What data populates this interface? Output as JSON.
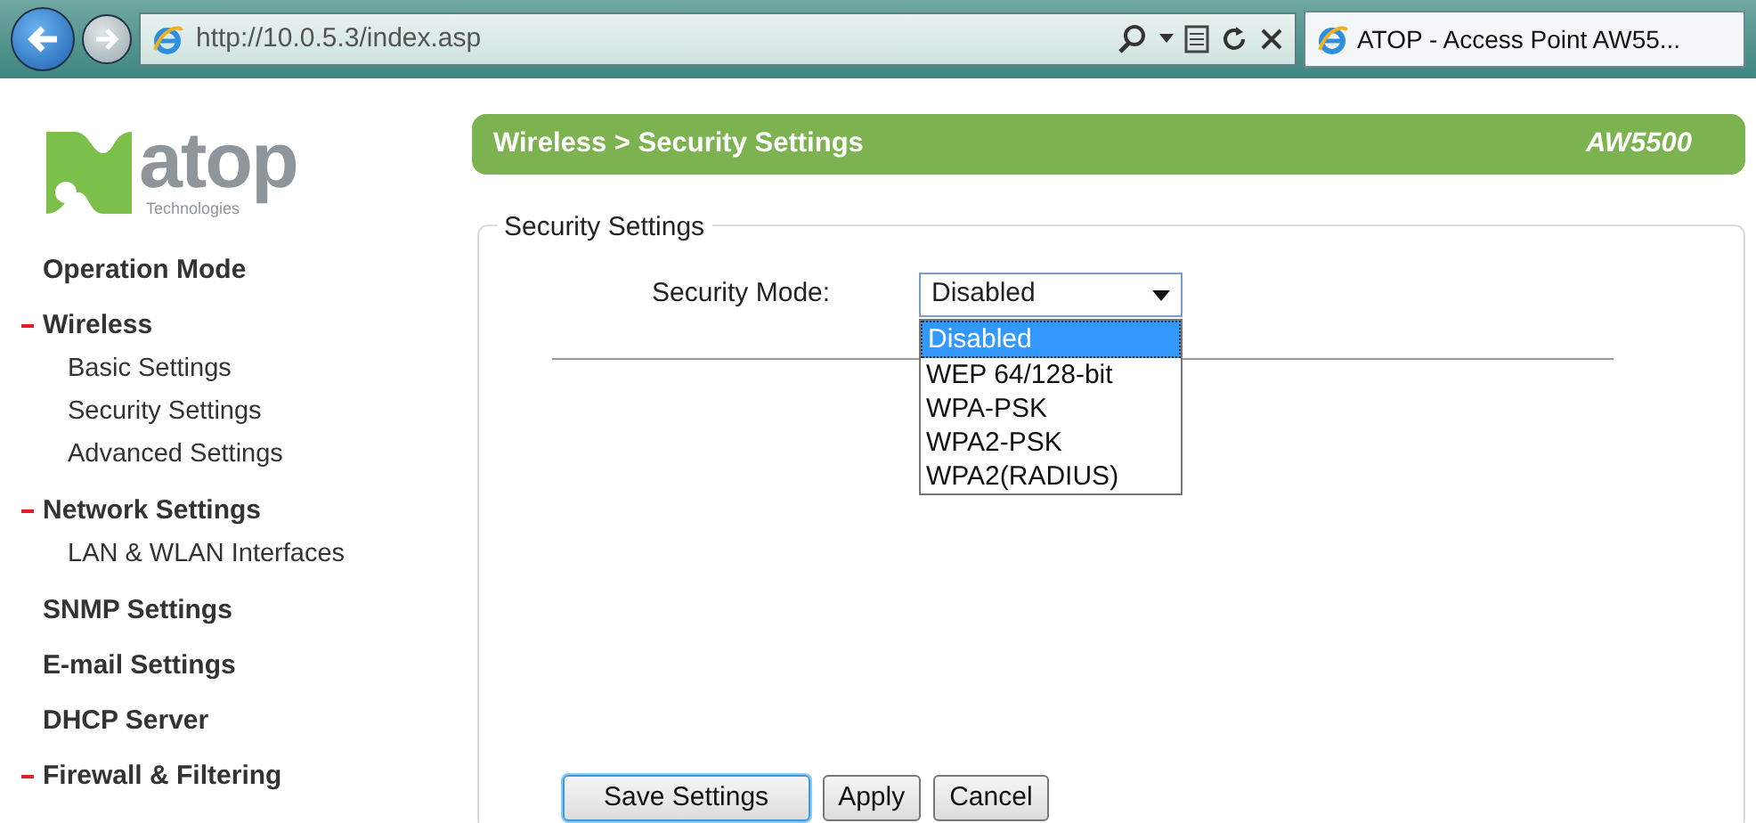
{
  "browser": {
    "url": "http://10.0.5.3/index.asp",
    "tab_title": "ATOP - Access Point AW55..."
  },
  "logo": {
    "name": "atop",
    "tagline": "Technologies"
  },
  "sidebar": {
    "items": [
      {
        "label": "Operation Mode",
        "kind": "section"
      },
      {
        "label": "Wireless",
        "kind": "section",
        "expanded": true,
        "children": [
          {
            "label": "Basic Settings"
          },
          {
            "label": "Security Settings"
          },
          {
            "label": "Advanced Settings"
          }
        ]
      },
      {
        "label": "Network Settings",
        "kind": "section",
        "expanded": true,
        "children": [
          {
            "label": "LAN & WLAN Interfaces"
          }
        ]
      },
      {
        "label": "SNMP Settings",
        "kind": "section"
      },
      {
        "label": "E-mail Settings",
        "kind": "section"
      },
      {
        "label": "DHCP Server",
        "kind": "section"
      },
      {
        "label": "Firewall & Filtering",
        "kind": "section",
        "expanded": true
      }
    ]
  },
  "header": {
    "breadcrumb": "Wireless > Security Settings",
    "model": "AW5500"
  },
  "fieldset": {
    "legend": "Security Settings",
    "field_label": "Security Mode:",
    "value": "Disabled",
    "expanded": true,
    "options": [
      {
        "label": "Disabled",
        "selected": true
      },
      {
        "label": "WEP 64/128-bit",
        "selected": false
      },
      {
        "label": "WPA-PSK",
        "selected": false
      },
      {
        "label": "WPA2-PSK",
        "selected": false
      },
      {
        "label": "WPA2(RADIUS)",
        "selected": false
      }
    ]
  },
  "buttons": [
    {
      "label": "Save Settings",
      "focused": true
    },
    {
      "label": "Apply",
      "focused": false
    },
    {
      "label": "Cancel",
      "focused": false
    }
  ]
}
